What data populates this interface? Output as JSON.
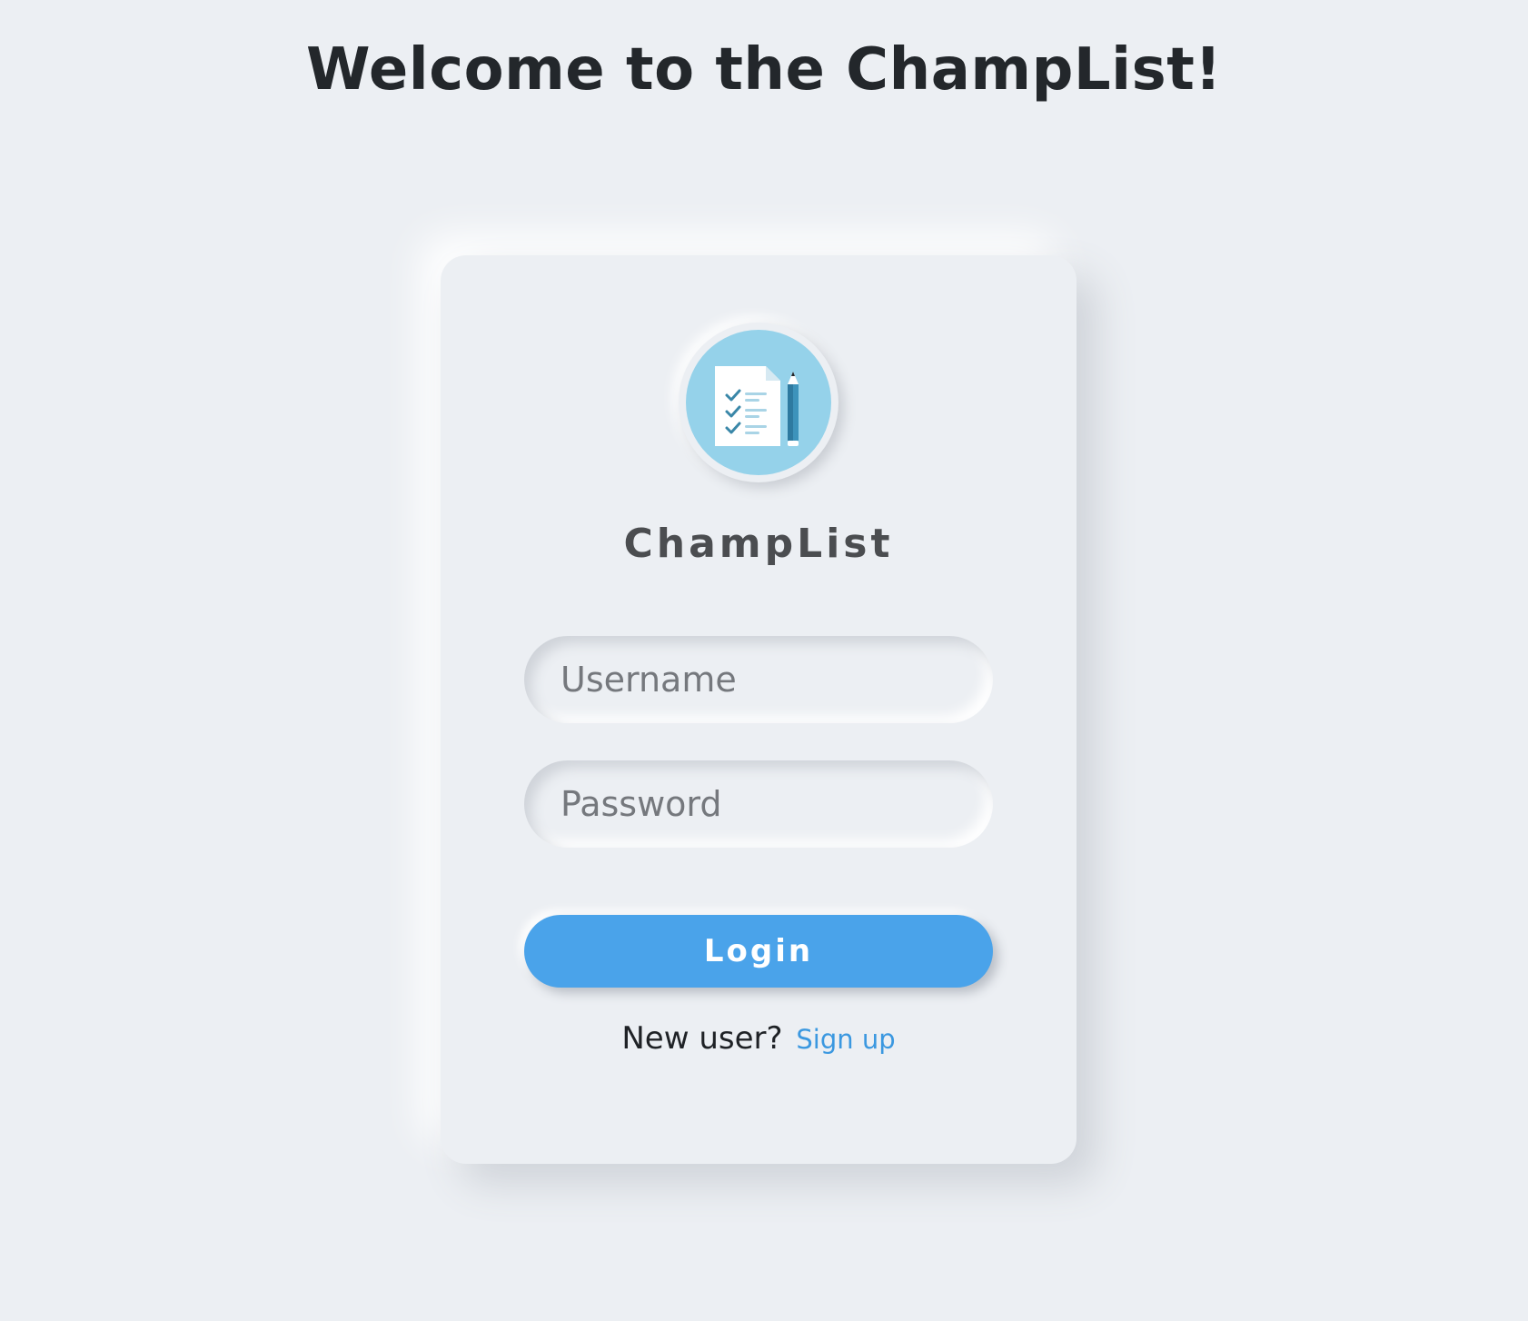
{
  "page": {
    "title": "Welcome to the ChampList!"
  },
  "login_card": {
    "logo_icon": "checklist-with-pencil-icon",
    "brand_name": "ChampList",
    "username_placeholder": "Username",
    "username_value": "",
    "password_placeholder": "Password",
    "password_value": "",
    "login_label": "Login",
    "signup_prompt": "New user?",
    "signup_link_label": "Sign up"
  },
  "colors": {
    "background": "#eceff3",
    "accent": "#4aa3ea",
    "link": "#3b98e0",
    "logo_circle": "#95d2ea",
    "title_text": "#23272b",
    "brand_text": "#4b4d50"
  }
}
